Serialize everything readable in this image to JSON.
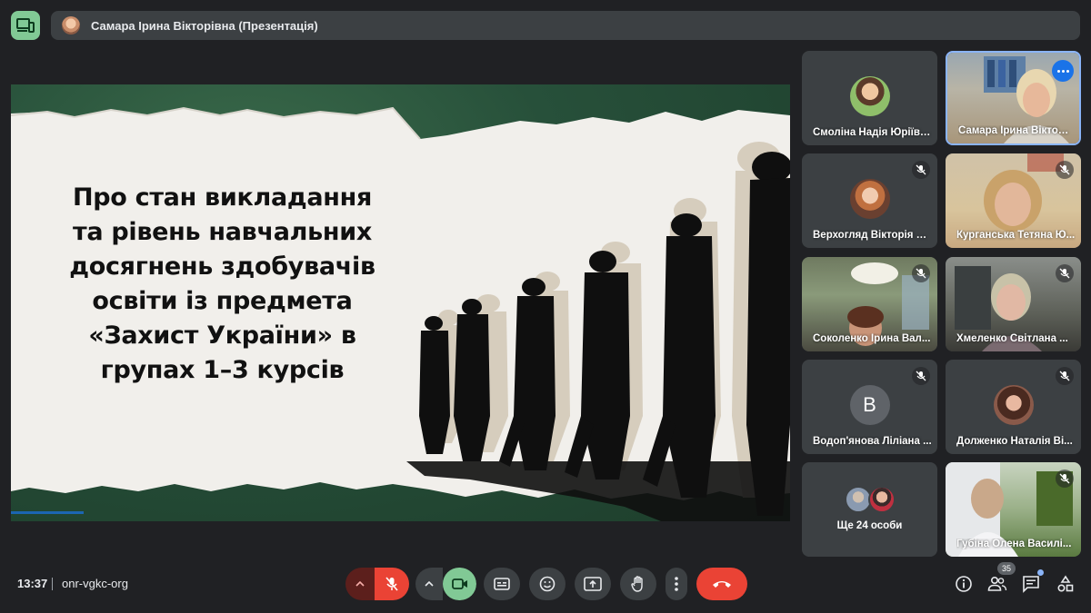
{
  "header": {
    "presenter_title": "Самара Ірина Вікторівна (Презентація)"
  },
  "slide": {
    "title_lines": [
      "Про стан викладання",
      "та рівень навчальних",
      "досягнень здобувачів",
      "освіти із предмета",
      "«Захист України» в",
      "групах 1–3 курсів"
    ]
  },
  "participants": [
    {
      "name": "Смоліна Надія Юріївна"
    },
    {
      "name": "Самара Ірина Вікторі..."
    },
    {
      "name": "Верхогляд Вікторія О..."
    },
    {
      "name": "Курганська Тетяна Ю..."
    },
    {
      "name": "Соколенко Ірина Вал..."
    },
    {
      "name": "Хмеленко Світлана ..."
    },
    {
      "name": "Водоп'янова Ліліана ...",
      "initial": "В"
    },
    {
      "name": "Долженко Наталія Ві..."
    },
    {
      "name": "Губіна Олена Василі..."
    }
  ],
  "others": {
    "label": "Ще 24 особи"
  },
  "footer": {
    "time": "13:37",
    "meeting_code": "onr-vgkc-org",
    "participant_count": "35"
  },
  "colors": {
    "accent": "#8ab4f8",
    "mic_off_red": "#ea4335",
    "camera_on_green": "#81c995",
    "end_call": "#ea4335"
  }
}
